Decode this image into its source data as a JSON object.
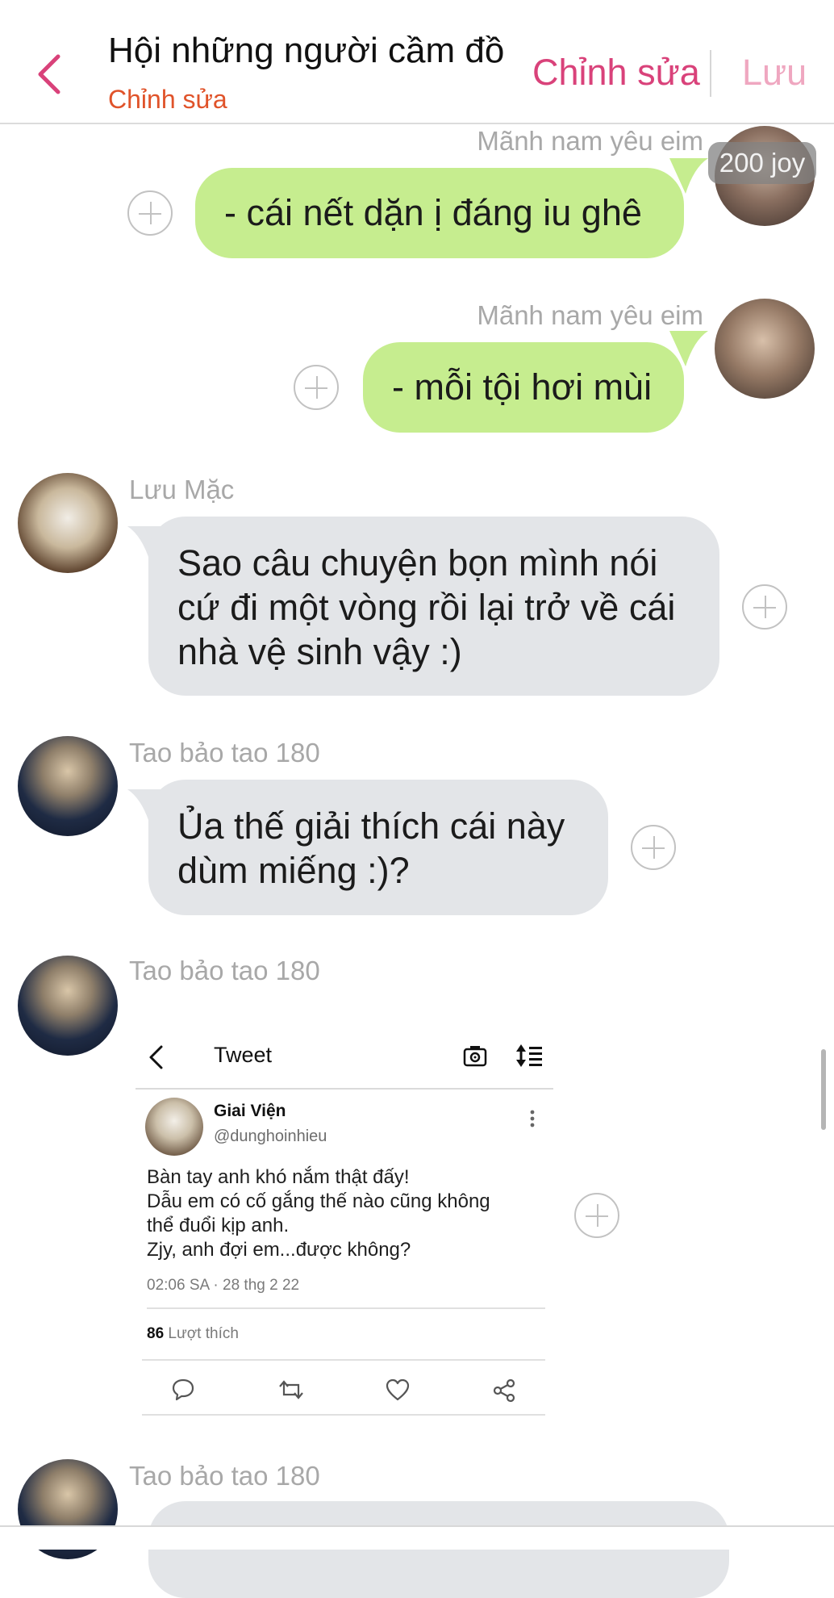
{
  "header": {
    "title": "Hội những người cầm đồ",
    "subtitle": "Chỉnh sửa",
    "edit_label": "Chỉnh sửa",
    "save_label": "Lưu"
  },
  "colors": {
    "accent": "#d9427a",
    "subtitle": "#e0532a",
    "bubble_green": "#c6ed8f",
    "bubble_grey": "#e3e5e8"
  },
  "messages": [
    {
      "sender": "Mãnh nam yêu eim",
      "text": "- cái nết dặn ị đáng iu ghê",
      "side": "right",
      "badge": "200 joy"
    },
    {
      "sender": "Mãnh nam yêu eim",
      "text": "- mỗi tội hơi mùi",
      "side": "right"
    },
    {
      "sender": "Lưu Mặc",
      "lines": [
        "Sao câu chuyện bọn mình nói",
        "cứ đi một vòng rồi lại trở về cái",
        "nhà vệ sinh vậy :)"
      ],
      "side": "left"
    },
    {
      "sender": "Tao bảo tao 180",
      "lines": [
        "Ủa thế giải thích cái này",
        "dùm miếng :)?"
      ],
      "side": "left"
    },
    {
      "sender": "Tao bảo tao 180",
      "side": "left",
      "type": "image"
    },
    {
      "sender": "Tao bảo tao 180",
      "side": "left"
    }
  ],
  "tweet": {
    "header_title": "Tweet",
    "author_name": "Giai Viện",
    "author_handle": "@dunghoinhieu",
    "lines": [
      "Bàn tay anh khó nắm thật đấy!",
      "Dẫu em có cố gắng thế nào cũng không",
      "thể đuổi kịp anh.",
      "Zjy, anh đợi em...được không?"
    ],
    "timestamp": "02:06 SA · 28 thg 2 22",
    "likes_count": "86",
    "likes_label": "Lượt thích"
  }
}
